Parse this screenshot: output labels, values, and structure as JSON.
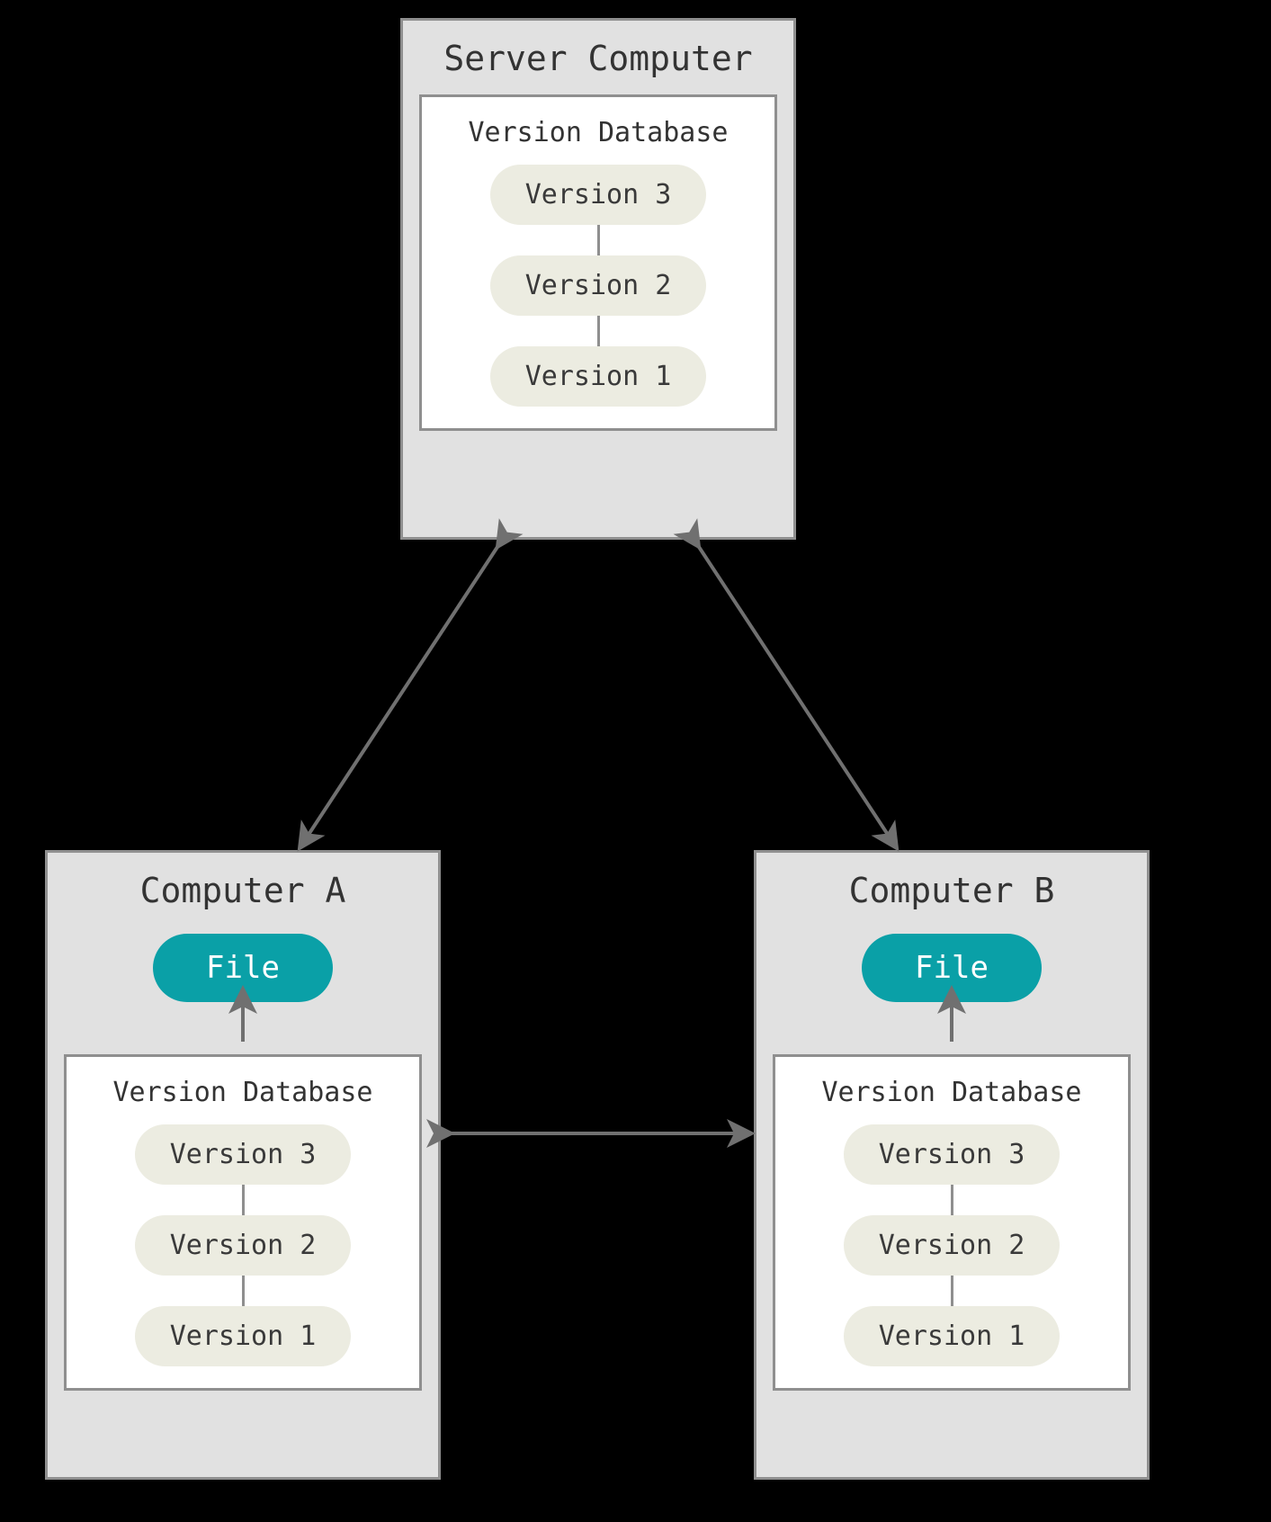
{
  "server": {
    "title": "Server Computer",
    "db_label": "Version Database",
    "versions": {
      "v3": "Version 3",
      "v2": "Version 2",
      "v1": "Version 1"
    }
  },
  "computer_a": {
    "title": "Computer A",
    "file_label": "File",
    "db_label": "Version Database",
    "versions": {
      "v3": "Version 3",
      "v2": "Version 2",
      "v1": "Version 1"
    }
  },
  "computer_b": {
    "title": "Computer B",
    "file_label": "File",
    "db_label": "Version Database",
    "versions": {
      "v3": "Version 3",
      "v2": "Version 2",
      "v1": "Version 1"
    }
  }
}
